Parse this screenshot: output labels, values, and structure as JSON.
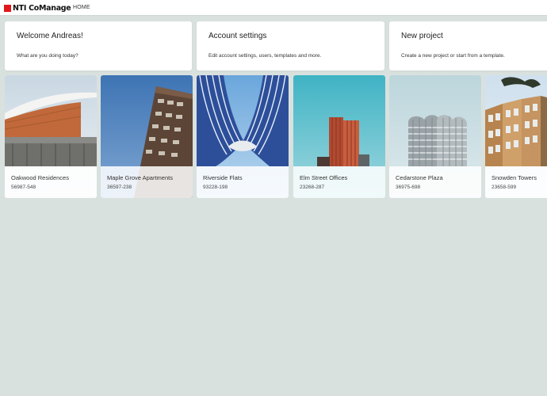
{
  "app": {
    "name": "NTI CoManage",
    "nav": {
      "home": "HOME"
    }
  },
  "cards": {
    "welcome": {
      "title": "Welcome Andreas!",
      "subtitle": "What are you doing today?"
    },
    "account": {
      "title": "Account settings",
      "subtitle": "Edit account settings, users, templates and more."
    },
    "new_project": {
      "title": "New project",
      "subtitle": "Create a new project or start from a template."
    }
  },
  "projects": [
    {
      "name": "Oakwood Residences",
      "code": "56987-548"
    },
    {
      "name": "Maple Grove Apartments",
      "code": "36597-238"
    },
    {
      "name": "Riverside Flats",
      "code": "93228-198"
    },
    {
      "name": "Elm Street Offices",
      "code": "23268-287"
    },
    {
      "name": "Cedarstone Plaza",
      "code": "36975-698"
    },
    {
      "name": "Snowden Towers",
      "code": "23658-599"
    }
  ],
  "colors": {
    "brand": "#e0161b",
    "background": "#d9e1df"
  }
}
